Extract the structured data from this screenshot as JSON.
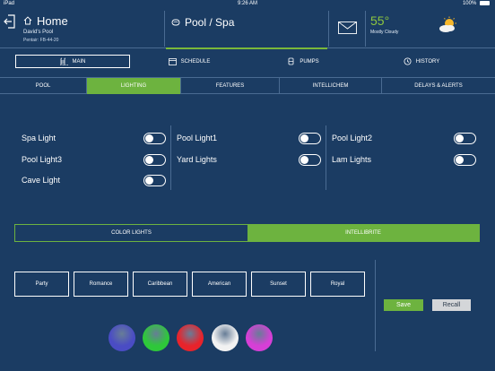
{
  "status_bar": {
    "carrier": "iPad",
    "time": "9:26 AM",
    "battery": "100%"
  },
  "header": {
    "home_title": "Home",
    "pool_name": "David's Pool",
    "device_id": "Pentair: FB-44-20",
    "section_title": "Pool / Spa",
    "weather_temp": "55°",
    "weather_desc": "Mostly Cloudy"
  },
  "menu": {
    "items": [
      {
        "label": "MAIN",
        "icon": "pool-ladder-icon",
        "active": true
      },
      {
        "label": "SCHEDULE",
        "icon": "calendar-icon",
        "active": false
      },
      {
        "label": "PUMPS",
        "icon": "pump-icon",
        "active": false
      },
      {
        "label": "HISTORY",
        "icon": "history-icon",
        "active": false
      }
    ]
  },
  "tabs": {
    "items": [
      {
        "label": "POOL",
        "active": false
      },
      {
        "label": "LIGHTING",
        "active": true
      },
      {
        "label": "FEATURES",
        "active": false
      },
      {
        "label": "INTELLICHEM",
        "active": false
      },
      {
        "label": "DELAYS & ALERTS",
        "active": false
      }
    ]
  },
  "lights": {
    "col1": [
      {
        "label": "Spa Light",
        "on": false
      },
      {
        "label": "Pool Light3",
        "on": false
      },
      {
        "label": "Cave Light",
        "on": false
      }
    ],
    "col2": [
      {
        "label": "Pool Light1",
        "on": false
      },
      {
        "label": "Yard Lights",
        "on": false
      }
    ],
    "col3": [
      {
        "label": "Pool Light2",
        "on": false
      },
      {
        "label": "Lam Lights",
        "on": false
      }
    ]
  },
  "mode": {
    "color_lights": "COLOR LIGHTS",
    "intellibrite": "INTELLIBRITE",
    "active": "intellibrite"
  },
  "scenes": [
    "Party",
    "Romance",
    "Caribbean",
    "American",
    "Sunset",
    "Royal"
  ],
  "colors": [
    "#4a4cc4",
    "#2ec83a",
    "#e8232b",
    "#f2f2f2",
    "#d63fd6"
  ],
  "actions": {
    "save": "Save",
    "recall": "Recall"
  },
  "theme": {
    "background": "#1b3c63",
    "accent": "#6db33f",
    "divider": "#4a6b92"
  }
}
